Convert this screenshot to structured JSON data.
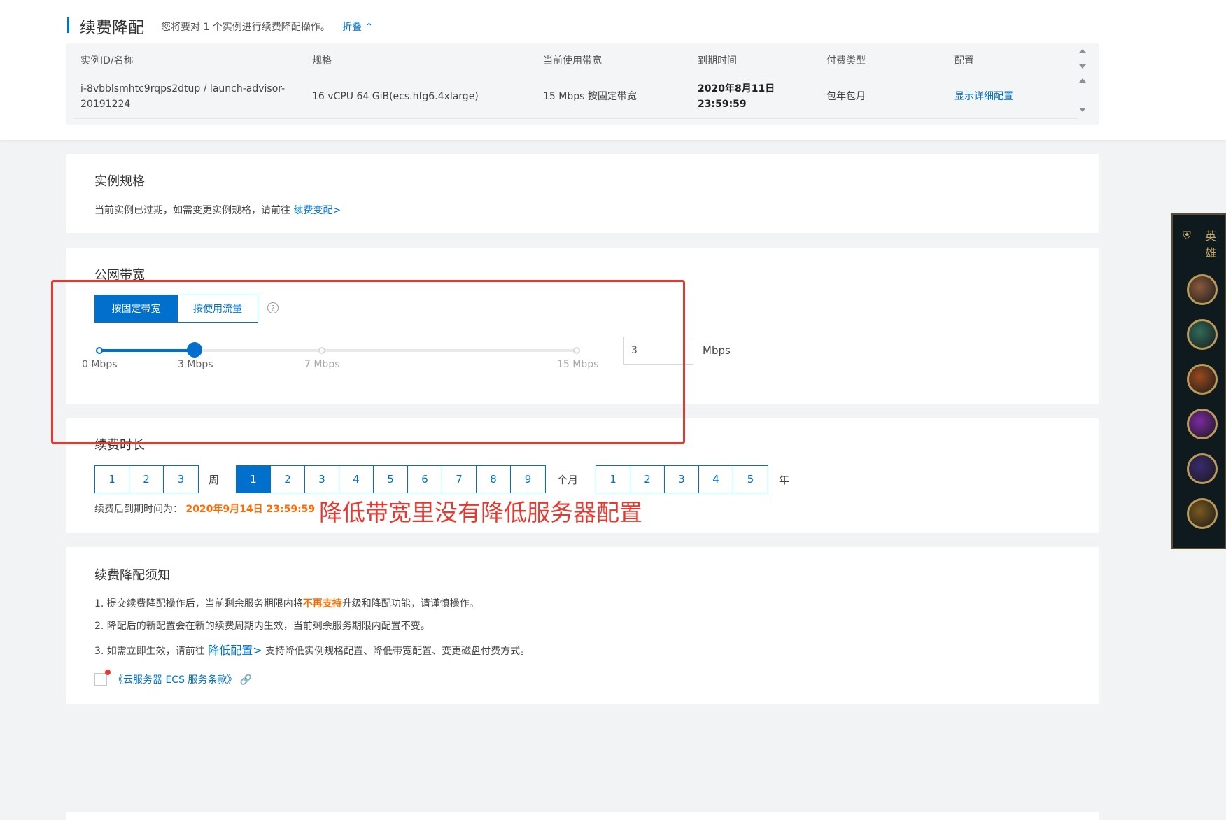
{
  "header": {
    "title": "续费降配",
    "subtitle": "您将要对 1 个实例进行续费降配操作。",
    "collapse_label": "折叠"
  },
  "instance_table": {
    "columns": [
      "实例ID/名称",
      "规格",
      "当前使用带宽",
      "到期时间",
      "付费类型",
      "配置"
    ],
    "row": {
      "id_line1": "i-8vbblsmhtc9rqps2dtup / launch-advisor-",
      "id_line2": "20191224",
      "spec": "16 vCPU 64 GiB(ecs.hfg6.4xlarge)",
      "bandwidth": "15 Mbps 按固定带宽",
      "expire_date": "2020年8月11日",
      "expire_time": "23:59:59",
      "pay_type": "包年包月",
      "config_link": "显示详细配置"
    }
  },
  "spec_section": {
    "title": "实例规格",
    "desc": "当前实例已过期，如需变更实例规格，请前往",
    "link": "续费变配>"
  },
  "bandwidth_section": {
    "title": "公网带宽",
    "tabs": [
      "按固定带宽",
      "按使用流量"
    ],
    "active_tab": "按固定带宽",
    "help": "?",
    "ticks": [
      "0 Mbps",
      "3 Mbps",
      "7 Mbps",
      "15 Mbps"
    ],
    "slider_value": 3,
    "slider_max": 15,
    "input_value": "3",
    "unit": "Mbps"
  },
  "duration_section": {
    "title": "续费时长",
    "weeks": [
      "1",
      "2",
      "3"
    ],
    "week_unit": "周",
    "months": [
      "1",
      "2",
      "3",
      "4",
      "5",
      "6",
      "7",
      "8",
      "9"
    ],
    "month_unit": "个月",
    "selected_month": "1",
    "years": [
      "1",
      "2",
      "3",
      "4",
      "5"
    ],
    "year_unit": "年",
    "expire_label": "续费后到期时间为：",
    "expire_value": "2020年9月14日 23:59:59"
  },
  "annotation": "降低带宽里没有降低服务器配置",
  "notice_section": {
    "title": "续费降配须知",
    "item1_pre": "1. 提交续费降配操作后，当前剩余服务期限内将",
    "item1_highlight": "不再支持",
    "item1_post": "升级和降配功能，请谨慎操作。",
    "item2": "2. 降配后的新配置会在新的续费周期内生效，当前剩余服务期限内配置不变。",
    "item3_pre": "3. 如需立即生效，请前往",
    "item3_link": "降低配置>",
    "item3_post": "支持降低实例规格配置、降低带宽配置、变更磁盘付费方式。",
    "terms": "《云服务器 ECS 服务条款》"
  },
  "game_panel": {
    "title": "英雄",
    "avatar_colors": [
      "#8a5a3c",
      "#2f6b5a",
      "#9a4a1e",
      "#7b2aa0",
      "#3a2a6e",
      "#7a5a1e"
    ]
  },
  "colors": {
    "primary": "#0070cc",
    "annotation_red": "#e5382f",
    "highlight_orange": "#ff6a00"
  }
}
